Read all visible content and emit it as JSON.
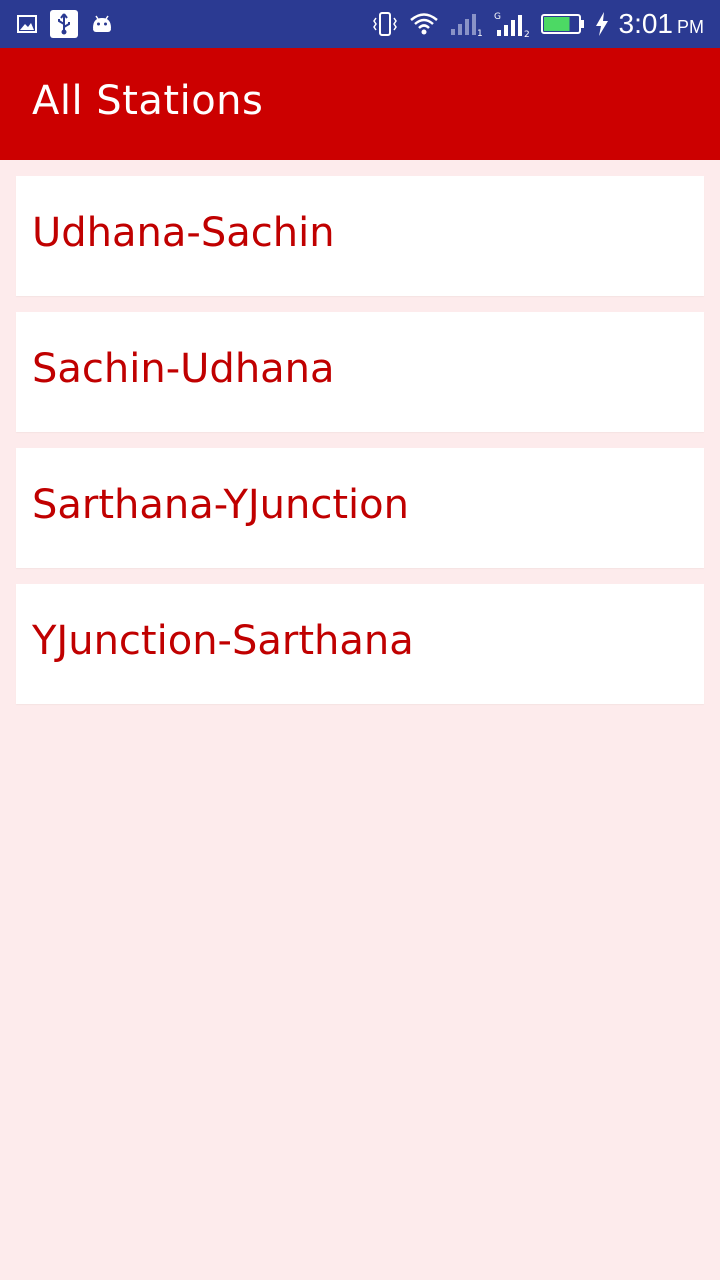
{
  "status_bar": {
    "time": "3:01",
    "ampm": "PM",
    "icons_left": [
      "image-icon",
      "usb-icon",
      "android-icon"
    ],
    "icons_right": [
      "vibrate-icon",
      "wifi-icon",
      "signal-sim1-icon",
      "signal-sim2-icon",
      "battery-icon",
      "charging-icon"
    ],
    "battery_level": 0.75,
    "network_label": "G"
  },
  "app_bar": {
    "title": "All Stations",
    "color": "#cc0000"
  },
  "stations": [
    {
      "label": "Udhana-Sachin"
    },
    {
      "label": "Sachin-Udhana"
    },
    {
      "label": "Sarthana-YJunction"
    },
    {
      "label": "YJunction-Sarthana"
    }
  ],
  "colors": {
    "status_bar": "#2b3a92",
    "background": "#fdebec",
    "item_text": "#c00000",
    "battery": "#4cd964"
  }
}
